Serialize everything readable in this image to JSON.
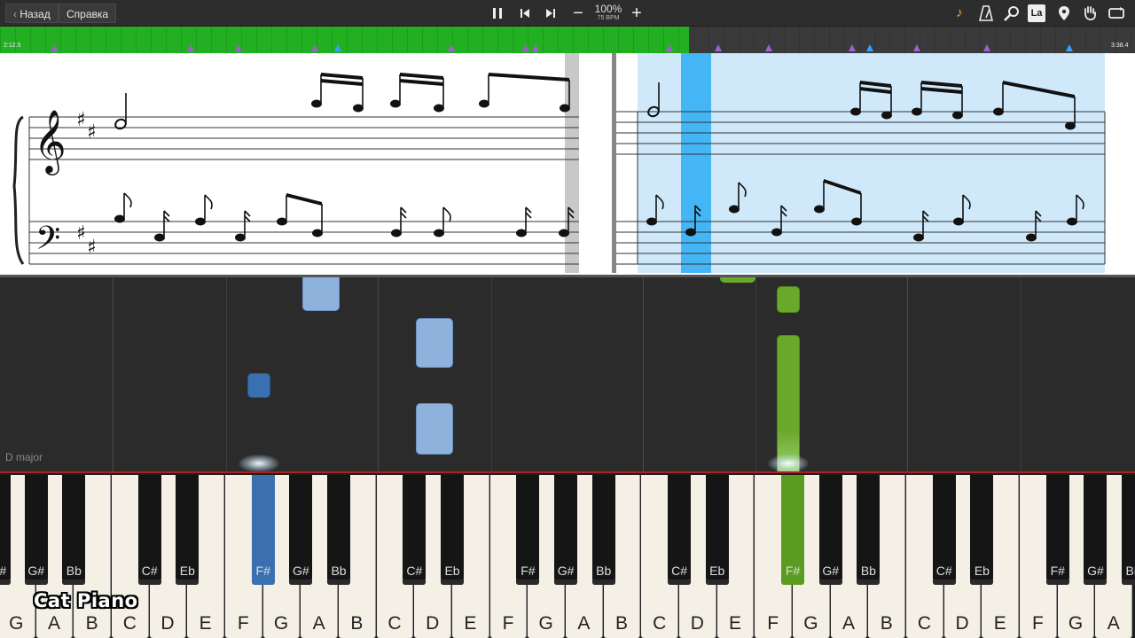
{
  "toolbar": {
    "back_label": "Назад",
    "help_label": "Справка",
    "tempo_percent": "100%",
    "tempo_bpm": "75 BPM",
    "icons": [
      "pause-icon",
      "skip-back-icon",
      "skip-forward-icon",
      "minus-icon",
      "plus-icon",
      "note-icon",
      "metronome-icon",
      "search-icon",
      "la-label-icon",
      "location-pin-icon",
      "hand-icon",
      "loop-icon"
    ],
    "la_label": "La"
  },
  "timeline": {
    "elapsed": "2:12.5",
    "total": "3:38.4",
    "progress": 0.607,
    "accent": "#22b022"
  },
  "piano_roll": {
    "key_signature": "D major"
  },
  "keyboard": {
    "white_keys": [
      "G",
      "A",
      "B",
      "C",
      "D",
      "E",
      "F",
      "G",
      "A",
      "B",
      "C",
      "D",
      "E",
      "F",
      "G",
      "A",
      "B",
      "C",
      "D",
      "E",
      "F",
      "G",
      "A",
      "B",
      "C",
      "D",
      "E",
      "F",
      "G",
      "A"
    ],
    "black_keys": [
      "F#",
      "G#",
      "Bb",
      "C#",
      "Eb",
      "F#",
      "G#",
      "Bb",
      "C#",
      "Eb",
      "F#",
      "G#",
      "Bb",
      "C#",
      "Eb",
      "F#",
      "G#",
      "Bb",
      "C#",
      "Eb",
      "F#",
      "G#",
      "Bb"
    ],
    "active_left": "F#",
    "active_right": "F#",
    "left_hand_color": "#3a6fb0",
    "right_hand_color": "#5b9b22"
  },
  "watermark": "Cat Piano"
}
